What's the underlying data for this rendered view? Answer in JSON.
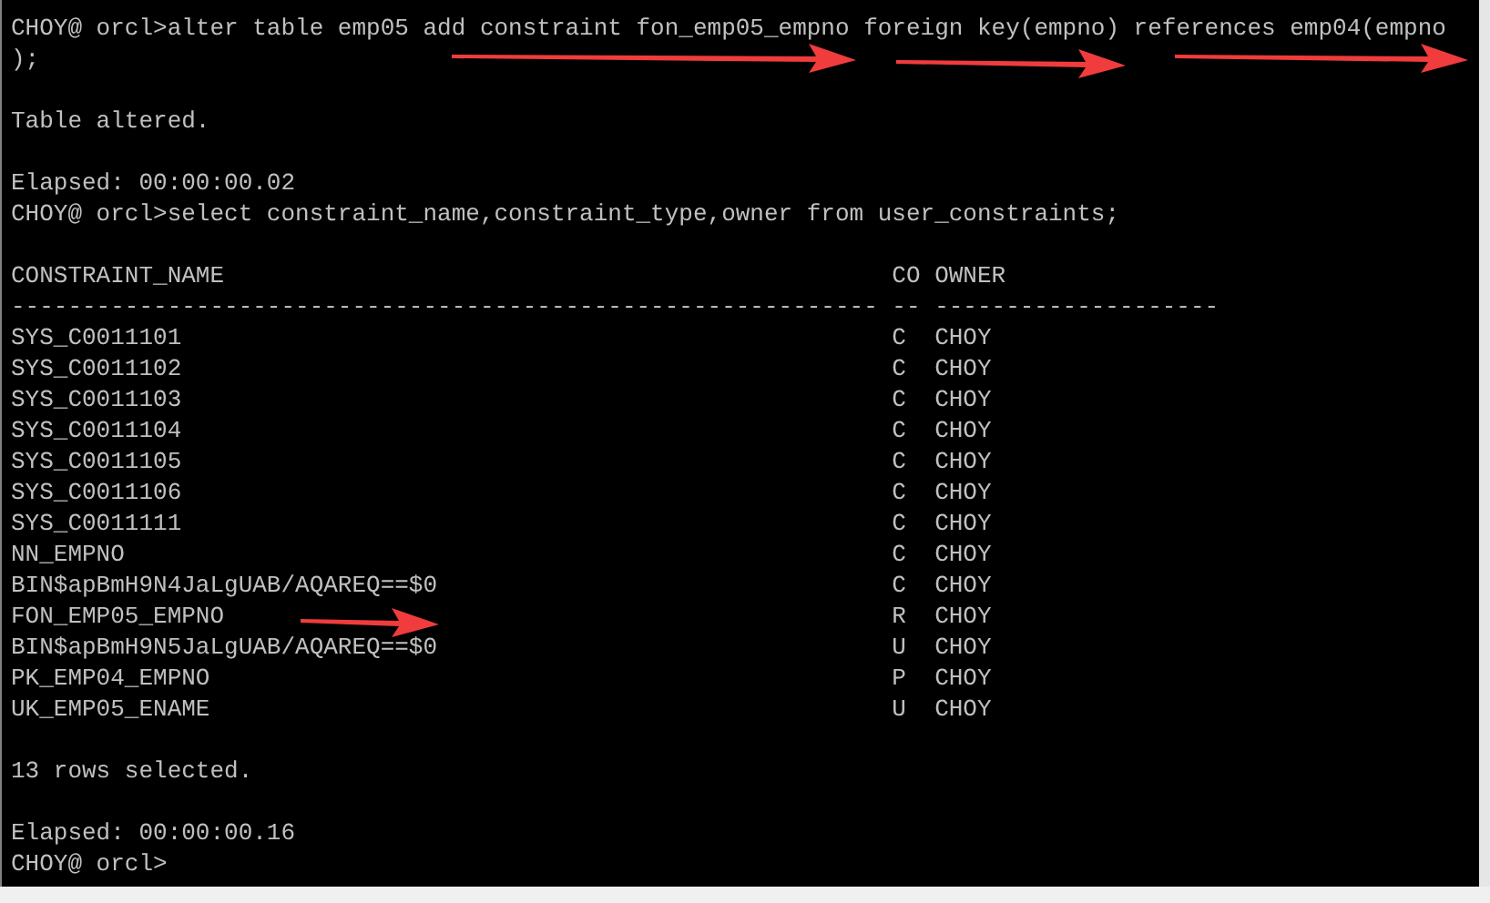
{
  "console": {
    "blocks_before": [
      [
        "CHOY@ orcl>alter table emp05 add constraint fon_emp05_empno foreign key(empno) references emp04(empno",
        ");"
      ],
      [
        "Table altered."
      ],
      [
        "Elapsed: 00:00:00.02",
        "CHOY@ orcl>select constraint_name,constraint_type,owner from user_constraints;"
      ]
    ],
    "table": {
      "columns": [
        "CONSTRAINT_NAME",
        "CO",
        "OWNER"
      ],
      "separators": [
        "-------------------------------------------------------------",
        "--",
        "--------------------"
      ],
      "rows": [
        [
          "SYS_C0011101",
          "C",
          "CHOY"
        ],
        [
          "SYS_C0011102",
          "C",
          "CHOY"
        ],
        [
          "SYS_C0011103",
          "C",
          "CHOY"
        ],
        [
          "SYS_C0011104",
          "C",
          "CHOY"
        ],
        [
          "SYS_C0011105",
          "C",
          "CHOY"
        ],
        [
          "SYS_C0011106",
          "C",
          "CHOY"
        ],
        [
          "SYS_C0011111",
          "C",
          "CHOY"
        ],
        [
          "NN_EMPNO",
          "C",
          "CHOY"
        ],
        [
          "BIN$apBmH9N4JaLgUAB/AQAREQ==$0",
          "C",
          "CHOY"
        ],
        [
          "FON_EMP05_EMPNO",
          "R",
          "CHOY"
        ],
        [
          "BIN$apBmH9N5JaLgUAB/AQAREQ==$0",
          "U",
          "CHOY"
        ],
        [
          "PK_EMP04_EMPNO",
          "P",
          "CHOY"
        ],
        [
          "UK_EMP05_ENAME",
          "U",
          "CHOY"
        ]
      ]
    },
    "blocks_after": [
      [
        "13 rows selected."
      ],
      [
        "Elapsed: 00:00:00.16",
        "CHOY@ orcl>"
      ]
    ]
  }
}
